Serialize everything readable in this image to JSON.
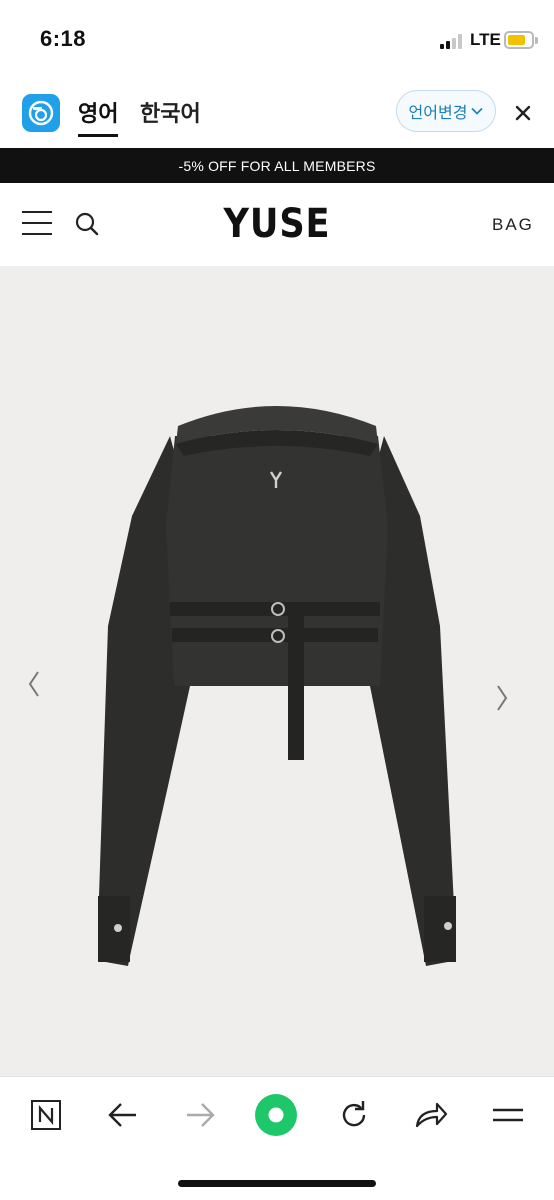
{
  "status_bar": {
    "time": "6:18",
    "network": "LTE",
    "battery_level": 0.6,
    "battery_color": "#f2c100"
  },
  "translate_bar": {
    "icon": "papago-icon",
    "active_language": "영어",
    "other_language": "한국어",
    "change_language_label": "언어변경",
    "close_icon": "close-icon",
    "accent_color": "#1fa0e9"
  },
  "promo": {
    "text": "-5% OFF FOR ALL MEMBERS"
  },
  "header": {
    "menu_icon": "hamburger-menu-icon",
    "search_icon": "search-icon",
    "logo": "YUSE",
    "bag_label": "BAG"
  },
  "product": {
    "image_description_icon": "product-photo",
    "prev_icon": "chevron-left-icon",
    "next_icon": "chevron-right-icon"
  },
  "toolbar": {
    "items": [
      {
        "icon": "naver-n-icon"
      },
      {
        "icon": "back-arrow-icon"
      },
      {
        "icon": "forward-arrow-icon"
      },
      {
        "icon": "green-dot-home-icon"
      },
      {
        "icon": "reload-icon"
      },
      {
        "icon": "share-icon"
      },
      {
        "icon": "menu-lines-icon"
      }
    ],
    "home_color": "#1ec86a"
  }
}
